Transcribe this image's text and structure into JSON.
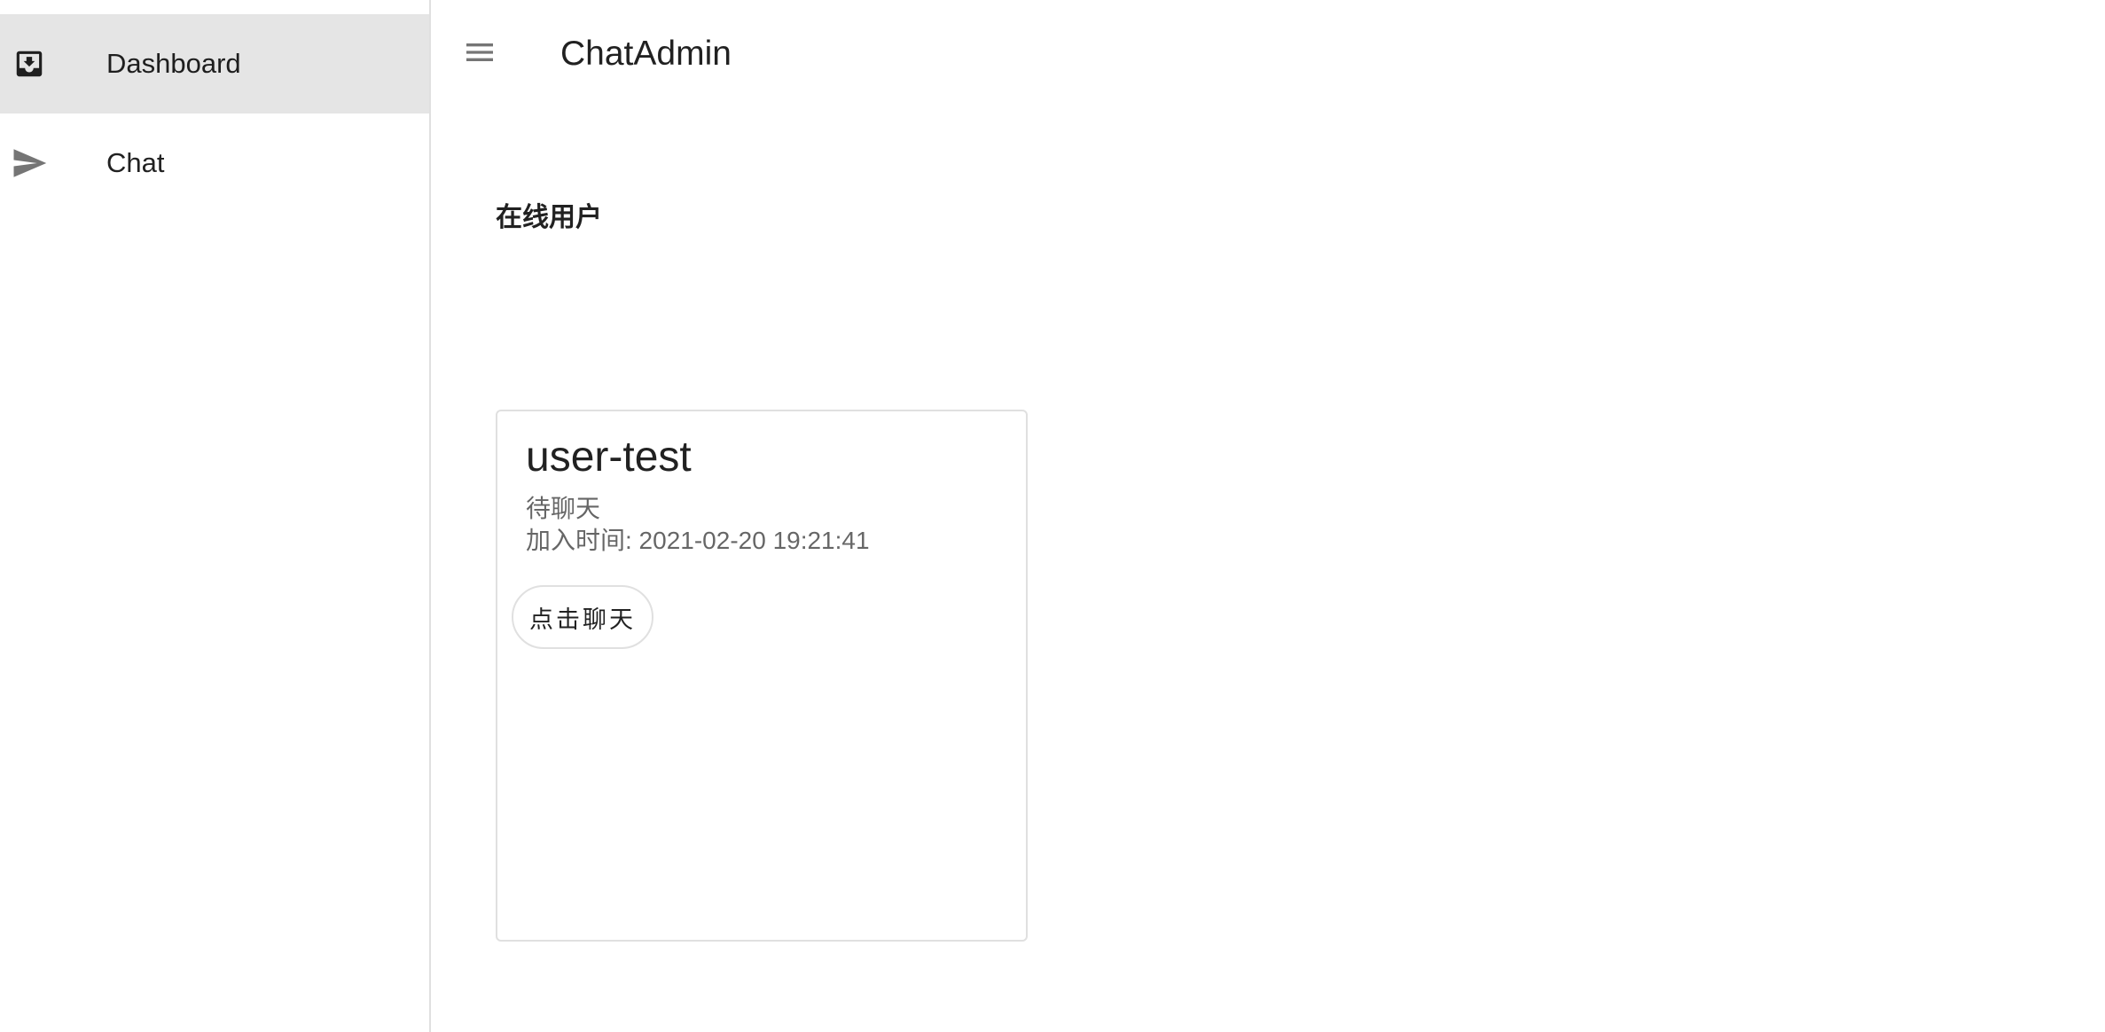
{
  "app": {
    "title": "ChatAdmin"
  },
  "sidebar": {
    "items": [
      {
        "label": "Dashboard",
        "icon": "inbox-download-icon",
        "active": true
      },
      {
        "label": "Chat",
        "icon": "send-icon",
        "active": false
      }
    ]
  },
  "main": {
    "section_title": "在线用户",
    "users": [
      {
        "name": "user-test",
        "status": "待聊天",
        "join_time": "加入时间: 2021-02-20 19:21:41",
        "chat_button_label": "点击聊天"
      }
    ]
  },
  "colors": {
    "active_nav_bg": "#e5e5e5",
    "border": "#e0e0e0",
    "icon": "#757575",
    "dashboard_icon": "#1f1f1f"
  }
}
